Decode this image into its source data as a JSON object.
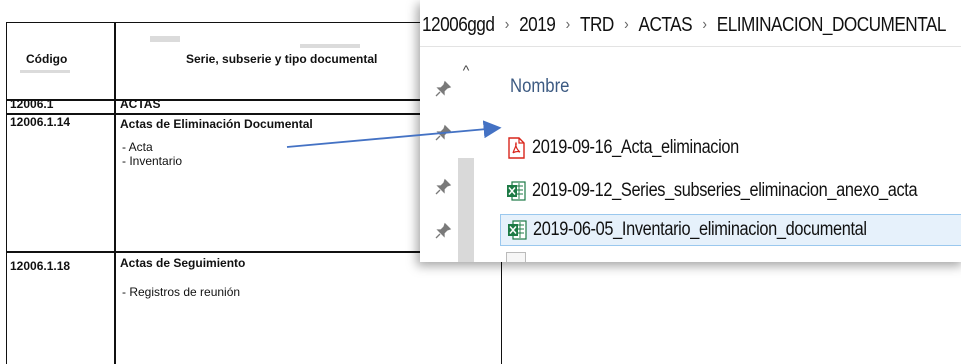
{
  "document": {
    "header": {
      "codigo": "Código",
      "serie": "Serie, subserie y tipo documental"
    },
    "rows": [
      {
        "code": "12006.1",
        "title": "ACTAS",
        "items": []
      },
      {
        "code": "12006.1.14",
        "title": "Actas de Eliminación Documental",
        "items": [
          "- Acta",
          "- Inventario"
        ]
      },
      {
        "code": "12006.1.18",
        "title": "Actas de Seguimiento",
        "items": [
          "- Registros de reunión"
        ]
      }
    ]
  },
  "explorer": {
    "breadcrumb": [
      "12006ggd",
      "2019",
      "TRD",
      "ACTAS",
      "ELIMINACION_DOCUMENTAL"
    ],
    "column_header": "Nombre",
    "files": [
      {
        "name": "2019-09-16_Acta_eliminacion",
        "icon": "pdf-file-icon",
        "color": "#d9261c",
        "selected": false
      },
      {
        "name": "2019-09-12_Series_subseries_eliminacion_anexo_acta",
        "icon": "excel-file-icon",
        "color": "#1d7a45",
        "selected": false
      },
      {
        "name": "2019-06-05_Inventario_eliminacion_documental",
        "icon": "excel-file-icon",
        "color": "#1d7a45",
        "selected": true
      }
    ]
  },
  "colors": {
    "arrow": "#4472c4",
    "accent_header": "#3c5a82",
    "selection": "#e6f1fb"
  }
}
